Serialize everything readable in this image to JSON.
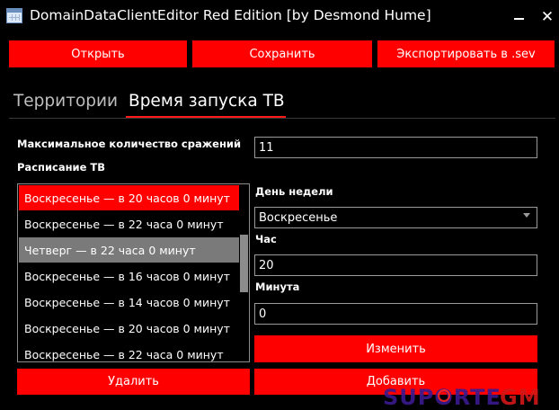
{
  "window": {
    "title": "DomainDataClientEditor Red Edition [by Desmond Hume]",
    "minimize_glyph": "—",
    "close_glyph": "✕"
  },
  "toolbar": {
    "open_label": "Открыть",
    "save_label": "Сохранить",
    "export_label": "Экспортировать в .sev"
  },
  "tabs": [
    {
      "label": "Территории",
      "active": false
    },
    {
      "label": "Время запуска ТВ",
      "active": true
    }
  ],
  "form": {
    "max_battles_label": "Максимальное количество сражений",
    "max_battles_value": "11",
    "schedule_label": "Расписание ТВ",
    "weekday_label": "День недели",
    "weekday_value": "Воскресенье",
    "hour_label": "Час",
    "hour_value": "20",
    "minute_label": "Минута",
    "minute_value": "0"
  },
  "schedule": {
    "items": [
      "Воскресенье — в 20 часов 0 минут",
      "Воскресенье — в 22 часа 0 минут",
      "Четверг — в 22 часа 0 минут",
      "Воскресенье — в 16 часов 0 минут",
      "Воскресенье — в 14 часов 0 минут",
      "Воскресенье — в 20 часов 0 минут",
      "Воскресенье — в 22 часа 0 минут"
    ],
    "selected_index": 0,
    "hover_index": 2
  },
  "actions": {
    "change_label": "Изменить",
    "delete_label": "Удалить",
    "add_label": "Добавить"
  },
  "watermark": {
    "text": "SUPORTEGM"
  },
  "colors": {
    "accent": "#ff0000",
    "background": "#000000",
    "hover": "#7a7a7a",
    "border": "#9a9a9a"
  },
  "icons": {
    "app": "table-window-icon",
    "minimize": "minimize-icon",
    "close": "close-icon",
    "dropdown": "chevron-down-icon"
  }
}
